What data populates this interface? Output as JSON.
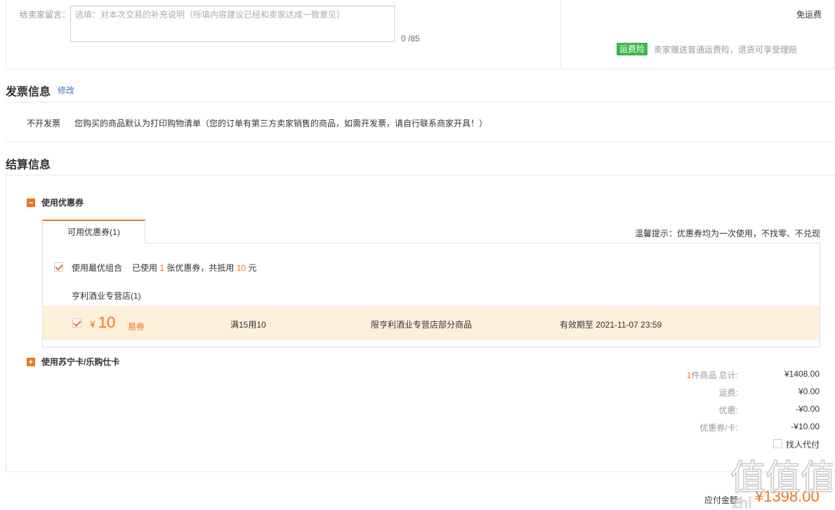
{
  "remark": {
    "label": "给卖家留言：",
    "placeholder": "选填：对本次交易的补充说明（所填内容建议已经和卖家达成一致意见）",
    "count": "0 /85"
  },
  "shipping": {
    "fee_text": "免运费",
    "insurance_badge": "运费险",
    "insurance_text": "卖家赠送普通运费险，退货可享受理赔"
  },
  "invoice": {
    "title": "发票信息",
    "edit": "修改",
    "type": "不开发票",
    "desc": "您购买的商品默认为打印购物清单（您的订单有第三方卖家销售的商品，如需开发票，请自行联系商家开具！）"
  },
  "settlement": {
    "title": "结算信息",
    "coupon_toggle": "使用优惠券",
    "coupon_toggle_icon": "minus-icon",
    "tab_label": "可用优惠券(1)",
    "tip": "温馨提示：优惠券均为一次使用，不找零、不兑现",
    "best_combo_label": "使用最优组合",
    "used_prefix": "已使用",
    "used_count": "1",
    "used_mid": "张优惠券，共抵用",
    "used_amount": "10",
    "used_suffix": "元",
    "shop_name": "亨利酒业专营店(1)",
    "coupon": {
      "currency": "¥",
      "amount": "10",
      "kind": "易券",
      "rule": "满15用10",
      "scope": "限亨利酒业专营店部分商品",
      "valid": "有效期至 2021-11-07 23:59",
      "checked": true
    },
    "card_toggle": "使用苏宁卡/乐购仕卡",
    "card_toggle_icon": "plus-icon"
  },
  "summary": {
    "item_count": "1",
    "item_label": "件商品 总计:",
    "total": "¥1408.00",
    "shipping_label": "运费:",
    "shipping": "¥0.00",
    "discount_label": "优惠:",
    "discount": "-¥0.00",
    "coupon_label": "优惠券/卡:",
    "coupon": "-¥10.00",
    "proxy_pay": "找人代付",
    "payable_label": "应付金额:",
    "payable": "¥1398.00"
  },
  "watermark": {
    "text": "值值值",
    "site": "zhi"
  },
  "colors": {
    "accent": "#f0741d",
    "insurance_green": "#3bb84a",
    "link_blue": "#3a76c5",
    "coupon_row_bg": "#fdf0da"
  }
}
